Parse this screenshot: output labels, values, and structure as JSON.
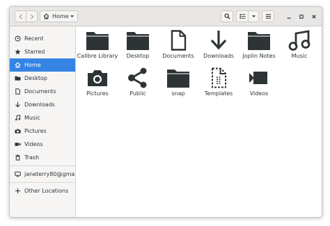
{
  "header": {
    "path_label": "Home",
    "back_icon": "chevron-left-icon",
    "forward_icon": "chevron-right-icon",
    "home_icon": "home-icon",
    "search_icon": "search-icon",
    "list_view_icon": "list-view-icon",
    "menu_icon": "hamburger-menu-icon"
  },
  "sidebar": {
    "items": [
      {
        "label": "Recent",
        "icon": "clock-icon"
      },
      {
        "label": "Starred",
        "icon": "star-icon"
      },
      {
        "label": "Home",
        "icon": "home-icon",
        "active": true
      },
      {
        "label": "Desktop",
        "icon": "folder-icon"
      },
      {
        "label": "Documents",
        "icon": "document-icon"
      },
      {
        "label": "Downloads",
        "icon": "download-icon"
      },
      {
        "label": "Music",
        "icon": "music-icon"
      },
      {
        "label": "Pictures",
        "icon": "camera-icon"
      },
      {
        "label": "Videos",
        "icon": "video-icon"
      },
      {
        "label": "Trash",
        "icon": "trash-icon"
      },
      {
        "label": "janeterry80@gma...",
        "icon": "account-icon"
      },
      {
        "label": "Other Locations",
        "icon": "plus-icon"
      }
    ]
  },
  "files": [
    {
      "name": "Calibre Library",
      "icon": "folder-icon"
    },
    {
      "name": "Desktop",
      "icon": "folder-icon"
    },
    {
      "name": "Documents",
      "icon": "document-icon"
    },
    {
      "name": "Downloads",
      "icon": "download-icon"
    },
    {
      "name": "Joplin Notes",
      "icon": "folder-icon"
    },
    {
      "name": "Music",
      "icon": "music-icon"
    },
    {
      "name": "Pictures",
      "icon": "camera-icon"
    },
    {
      "name": "Public",
      "icon": "share-icon"
    },
    {
      "name": "snap",
      "icon": "folder-icon"
    },
    {
      "name": "Templates",
      "icon": "template-icon"
    },
    {
      "name": "Videos",
      "icon": "video-icon"
    }
  ],
  "colors": {
    "accent": "#3584e4",
    "icon": "#2e3436"
  }
}
